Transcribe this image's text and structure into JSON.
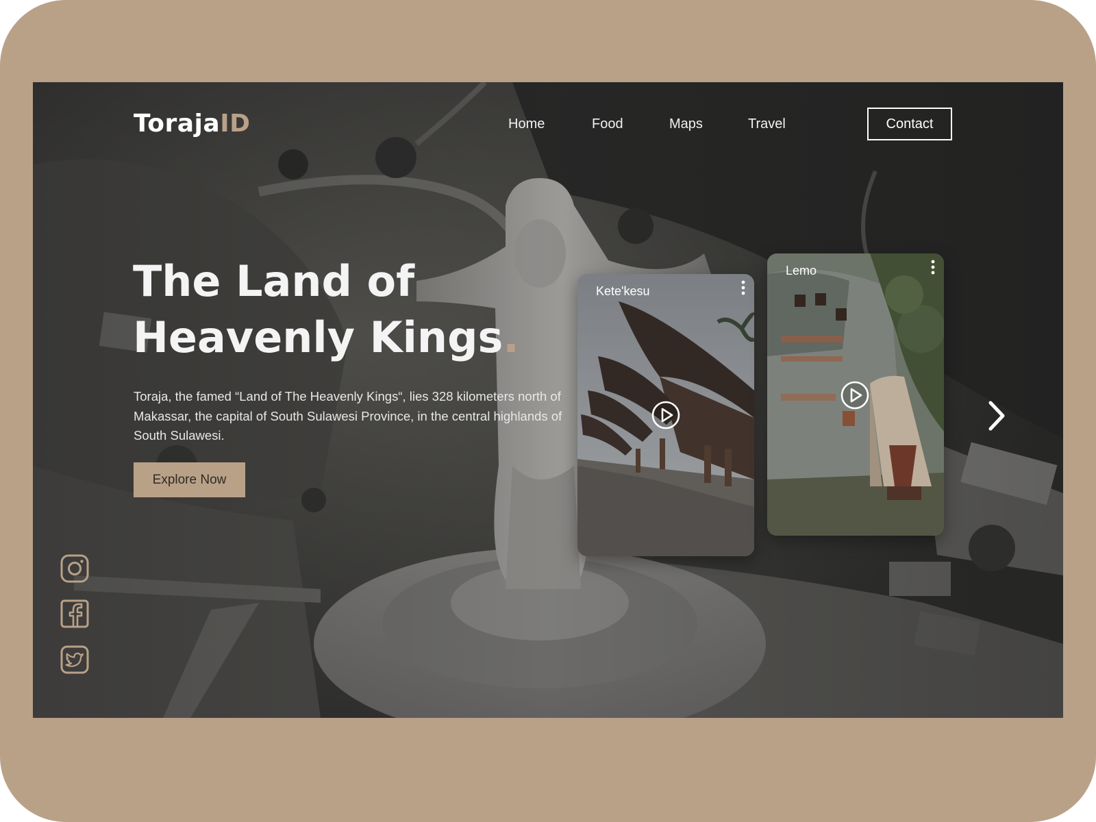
{
  "brand": {
    "name_main": "Toraja",
    "name_accent": "ID",
    "accent_color": "#b9a188",
    "frame_color": "#b9a188"
  },
  "nav": {
    "items": [
      {
        "label": "Home"
      },
      {
        "label": "Food"
      },
      {
        "label": "Maps"
      },
      {
        "label": "Travel"
      }
    ],
    "contact_label": "Contact"
  },
  "hero": {
    "title_line1": "The Land of",
    "title_line2": "Heavenly Kings",
    "title_dot": ".",
    "description": "Toraja, the famed “Land of The Heavenly Kings“, lies 328 kilometers north of Makassar, the capital of South Sulawesi Province, in the central highlands of South Sulawesi.",
    "cta_label": "Explore Now"
  },
  "social": {
    "icons": [
      "instagram-icon",
      "facebook-icon",
      "twitter-icon"
    ]
  },
  "cards": [
    {
      "label": "Kete'kesu",
      "play_icon": "play-icon",
      "menu_icon": "more-vertical-icon"
    },
    {
      "label": "Lemo",
      "play_icon": "play-icon",
      "menu_icon": "more-vertical-icon"
    }
  ],
  "carousel": {
    "next_icon": "chevron-right-icon"
  }
}
